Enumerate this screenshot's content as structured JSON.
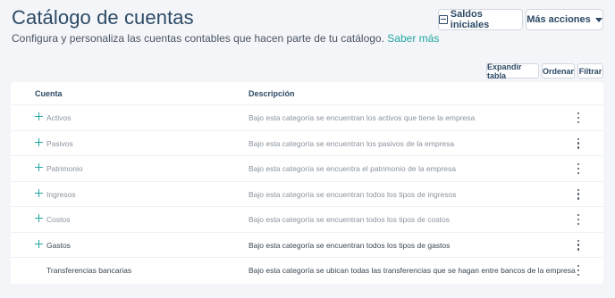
{
  "header": {
    "title": "Catálogo de cuentas",
    "subtitle": "Configura y personaliza las cuentas contables que hacen parte de tu catálogo.",
    "link": "Saber más"
  },
  "actions": {
    "saldos_label": "Saldos iniciales",
    "mas_label": "Más acciones"
  },
  "toolbar": {
    "expandir_label": "Expandir tabla",
    "ordenar_label": "Ordenar",
    "filtrar_label": "Filtrar"
  },
  "table": {
    "columns": [
      "Cuenta",
      "Descripción"
    ],
    "rows": [
      {
        "name": "Activos",
        "description": "Bajo esta categoría se encuentran los activos que tiene la empresa"
      },
      {
        "name": "Pasivos",
        "description": "Bajo esta categoría se encuentran los pasivos de la empresa"
      },
      {
        "name": "Patrimonio",
        "description": "Bajo esta categoría se encuentra el patrimonio de la empresa"
      },
      {
        "name": "Ingresos",
        "description": "Bajo esta categoría se encuentran todos los tipos de ingresos"
      },
      {
        "name": "Costos",
        "description": "Bajo esta categoría se encuentran todos los tipos de costos"
      },
      {
        "name": "Gastos",
        "description": "Bajo esta categoría se encuentran todos los tipos de gastos"
      },
      {
        "name": "Transferencias bancarias",
        "description": "Bajo esta categoría se ubican todas las transferencias que se hagan entre bancos de la empresa"
      }
    ]
  },
  "colors": {
    "accent": "#22a6a0",
    "title": "#2c4a66",
    "background": "#f4f5f8"
  },
  "icons": [
    "plus-icon",
    "kebab-menu-icon",
    "calculator-icon",
    "caret-down-icon"
  ]
}
